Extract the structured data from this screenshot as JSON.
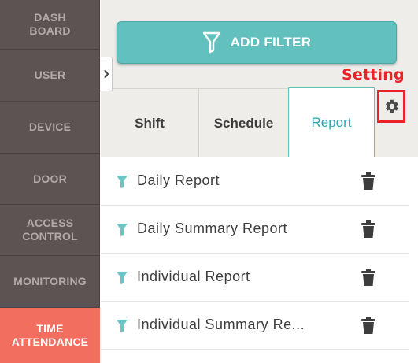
{
  "sidebar": {
    "items": [
      {
        "label": "DASH\nBOARD",
        "active": false
      },
      {
        "label": "USER",
        "active": false
      },
      {
        "label": "DEVICE",
        "active": false
      },
      {
        "label": "DOOR",
        "active": false
      },
      {
        "label": "ACCESS\nCONTROL",
        "active": false
      },
      {
        "label": "MONITORING",
        "active": false
      },
      {
        "label": "TIME\nATTENDANCE",
        "active": true
      }
    ]
  },
  "toolbar": {
    "add_filter_label": "ADD FILTER",
    "setting_annotation": "Setting"
  },
  "tabs": [
    {
      "label": "Shift",
      "active": false
    },
    {
      "label": "Schedule",
      "active": false
    },
    {
      "label": "Report",
      "active": true
    }
  ],
  "reports": [
    {
      "name": "Daily Report"
    },
    {
      "name": "Daily Summary Report"
    },
    {
      "name": "Individual Report"
    },
    {
      "name": "Individual Summary Re..."
    }
  ],
  "colors": {
    "sidebar_bg": "#5e5353",
    "sidebar_text": "#b3a9a9",
    "active_item": "#f26e5e",
    "accent_teal": "#62c1bf",
    "annotation_red": "#e8232a",
    "panel_bg": "#efedea"
  }
}
